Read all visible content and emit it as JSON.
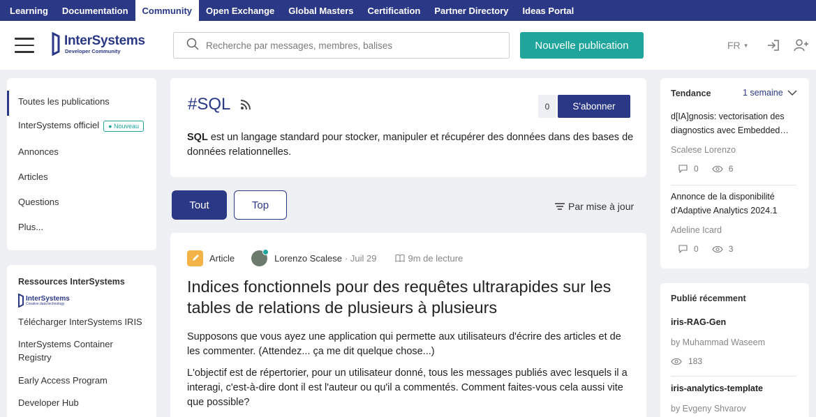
{
  "topnav": {
    "items": [
      {
        "label": "Learning"
      },
      {
        "label": "Documentation"
      },
      {
        "label": "Community"
      },
      {
        "label": "Open Exchange"
      },
      {
        "label": "Global Masters"
      },
      {
        "label": "Certification"
      },
      {
        "label": "Partner Directory"
      },
      {
        "label": "Ideas Portal"
      }
    ],
    "active": "Community"
  },
  "header": {
    "logo_name": "InterSystems",
    "logo_sub": "Developer Community",
    "search_placeholder": "Recherche par messages, membres, balises",
    "new_post": "Nouvelle publication",
    "lang": "FR"
  },
  "left_nav": {
    "items": [
      {
        "label": "Toutes les publications"
      },
      {
        "label": "InterSystems officiel",
        "badge": "Nouveau"
      },
      {
        "label": "Annonces"
      },
      {
        "label": "Articles"
      },
      {
        "label": "Questions"
      },
      {
        "label": "Plus..."
      }
    ]
  },
  "resources": {
    "title": "Ressources InterSystems",
    "logo_name": "InterSystems",
    "logo_sub": "Creative data technology",
    "items": [
      {
        "label": "Télécharger InterSystems IRIS"
      },
      {
        "label": "InterSystems Container Registry"
      },
      {
        "label": "Early Access Program"
      },
      {
        "label": "Developer Hub"
      }
    ]
  },
  "tag": {
    "title": "#SQL",
    "sub_count": "0",
    "subscribe": "S'abonner",
    "desc_bold": "SQL",
    "desc_rest": " est un langage standard pour stocker, manipuler et récupérer des données dans des bases de données relationnelles."
  },
  "filters": {
    "all": "Tout",
    "top": "Top",
    "sort": "Par mise à jour"
  },
  "article": {
    "type": "Article",
    "author": "Lorenzo Scalese",
    "date": "· Juil 29",
    "read": "9m de lecture",
    "title": "Indices fonctionnels pour des requêtes ultrarapides sur les tables de relations de plusieurs à plusieurs",
    "p1": "Supposons que vous ayez une application qui permette aux utilisateurs d'écrire des articles et de les commenter. (Attendez... ça me dit quelque chose...)",
    "p2": "L'objectif est de répertorier, pour un utilisateur donné, tous les messages publiés avec lesquels il a interagi, c'est-à-dire dont il est l'auteur ou qu'il a commentés. Comment faites-vous cela aussi vite que possible?"
  },
  "trending": {
    "title": "Tendance",
    "period": "1 semaine",
    "items": [
      {
        "title": "d[IA]gnosis: vectorisation des diagnostics avec Embedded…",
        "author": "Scalese Lorenzo",
        "comments": "0",
        "views": "6"
      },
      {
        "title": "Annonce de la disponibilité d'Adaptive Analytics 2024.1",
        "author": "Adeline Icard",
        "comments": "0",
        "views": "3"
      }
    ]
  },
  "recent": {
    "title": "Publié récemment",
    "items": [
      {
        "title": "iris-RAG-Gen",
        "author": "by Muhammad Waseem",
        "views": "183"
      },
      {
        "title": "iris-analytics-template",
        "author": "by Evgeny Shvarov"
      }
    ]
  },
  "colors": {
    "navy": "#2a3885",
    "teal": "#1fa59b",
    "bg": "#eef0f3"
  }
}
